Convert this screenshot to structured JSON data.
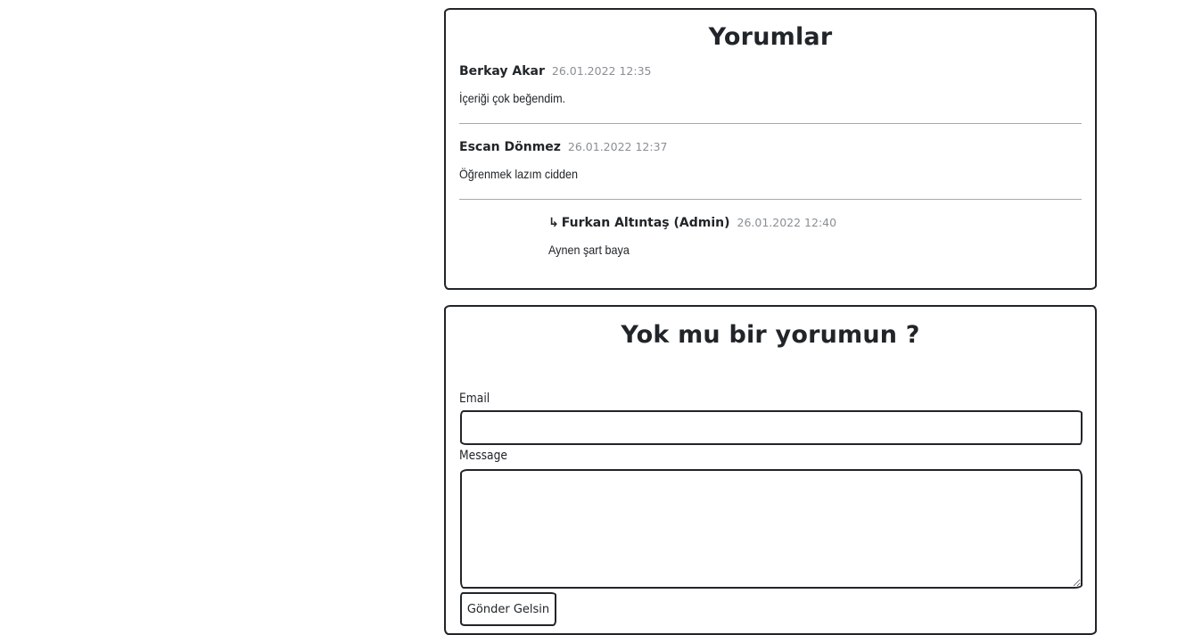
{
  "comments_section": {
    "title": "Yorumlar",
    "comments": [
      {
        "author": "Berkay Akar",
        "date": "26.01.2022 12:35",
        "text": "İçeriği çok beğendim."
      },
      {
        "author": "Escan Dönmez",
        "date": "26.01.2022 12:37",
        "text": "Öğrenmek lazım cidden"
      },
      {
        "reply_icon": "↳",
        "author": "Furkan Altıntaş (Admin)",
        "date": "26.01.2022 12:40",
        "text": "Aynen şart baya"
      }
    ]
  },
  "comment_form": {
    "title": "Yok mu bir yorumun ?",
    "email_label": "Email",
    "email_value": "",
    "message_label": "Message",
    "message_value": "",
    "submit_label": "Gönder Gelsin"
  }
}
